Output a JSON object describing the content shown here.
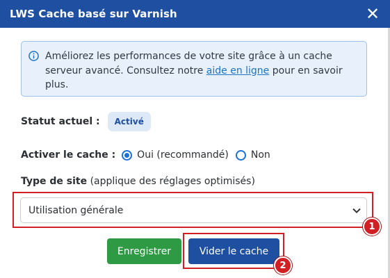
{
  "dialog": {
    "title": "LWS Cache basé sur Varnish",
    "close_symbol": "✕"
  },
  "info": {
    "text_before": "Améliorez les performances de votre site grâce à un cache serveur avancé. Consultez notre ",
    "link_text": "aide en ligne",
    "text_after": " pour en savoir plus.",
    "icon": "info-circle-icon"
  },
  "status": {
    "label": "Statut actuel :",
    "badge": "Activé"
  },
  "cache_toggle": {
    "label": "Activer le cache :",
    "options": [
      {
        "label": "Oui (recommandé)",
        "checked": true
      },
      {
        "label": "Non",
        "checked": false
      }
    ]
  },
  "site_type": {
    "label_bold": "Type de site",
    "label_hint": " (applique des réglages optimisés)",
    "selected": "Utilisation générale"
  },
  "buttons": {
    "save": "Enregistrer",
    "clear_cache": "Vider le cache"
  },
  "callouts": [
    "1",
    "2"
  ],
  "colors": {
    "header": "#1e4fa0",
    "save_button": "#2e9a44",
    "clear_button": "#1e4fa0",
    "highlight": "#d11f24",
    "info_bg": "#e8f1fb"
  }
}
